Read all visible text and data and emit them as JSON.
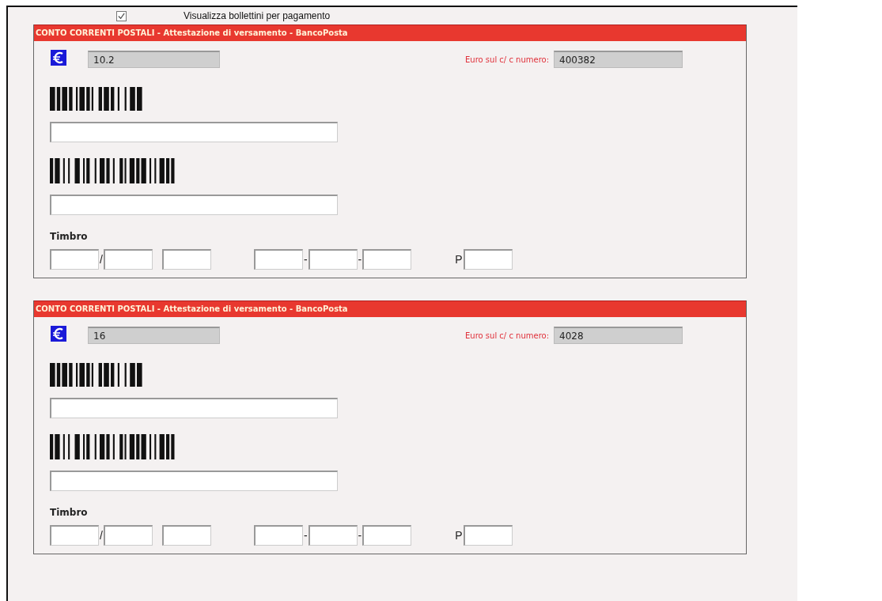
{
  "show_slips": {
    "label": "Visualizza bollettini per pagamento",
    "checked": true
  },
  "slips": [
    {
      "title": "CONTO CORRENTI POSTALI - Attestazione di versamento - BancoPosta",
      "amount": "10.2",
      "account_label": "Euro sul c/ c numero:",
      "account": "400382",
      "stamp_label": "Timbro",
      "stamp_parts": [
        {
          "kind": "field"
        },
        {
          "kind": "sep",
          "text": "/"
        },
        {
          "kind": "field"
        },
        {
          "kind": "gap"
        },
        {
          "kind": "field"
        },
        {
          "kind": "wide_gap"
        },
        {
          "kind": "field"
        },
        {
          "kind": "sep",
          "text": "-"
        },
        {
          "kind": "field"
        },
        {
          "kind": "sep",
          "text": "-"
        },
        {
          "kind": "field"
        },
        {
          "kind": "wide_gap"
        },
        {
          "kind": "sep",
          "text": "P"
        },
        {
          "kind": "field"
        }
      ]
    },
    {
      "title": "CONTO CORRENTI POSTALI - Attestazione di versamento - BancoPosta",
      "amount": "16",
      "account_label": "Euro sul c/ c numero:",
      "account": "4028",
      "stamp_label": "Timbro",
      "stamp_parts": [
        {
          "kind": "field"
        },
        {
          "kind": "sep",
          "text": "/"
        },
        {
          "kind": "field"
        },
        {
          "kind": "gap"
        },
        {
          "kind": "field"
        },
        {
          "kind": "wide_gap"
        },
        {
          "kind": "field"
        },
        {
          "kind": "sep",
          "text": "-"
        },
        {
          "kind": "field"
        },
        {
          "kind": "sep",
          "text": "-"
        },
        {
          "kind": "field"
        },
        {
          "kind": "wide_gap"
        },
        {
          "kind": "sep",
          "text": "P"
        },
        {
          "kind": "field"
        }
      ]
    }
  ]
}
